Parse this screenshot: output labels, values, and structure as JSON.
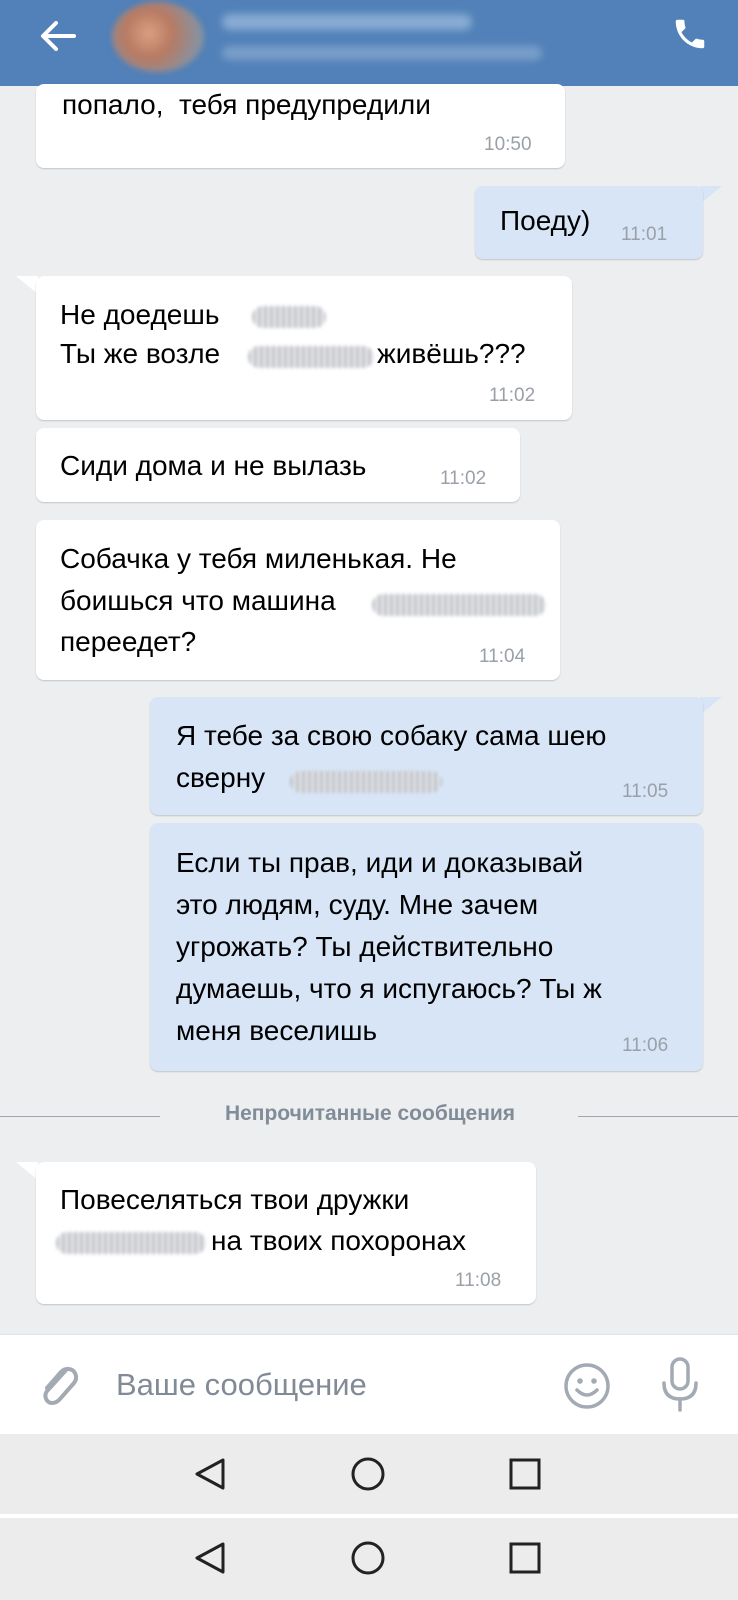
{
  "header": {
    "back_icon": "arrow-left-icon",
    "call_icon": "phone-icon",
    "accent_color": "#5181b8"
  },
  "messages": [
    {
      "direction": "in",
      "lines": [
        "попало,  тебя предупредили"
      ],
      "time": "10:50"
    },
    {
      "direction": "out",
      "lines": [
        "Поеду)"
      ],
      "time": "11:01"
    },
    {
      "direction": "in",
      "lines": [
        "Не доедешь",
        "Ты же возле",
        "живёшь???"
      ],
      "time": "11:02"
    },
    {
      "direction": "in",
      "lines": [
        "Сиди дома и не вылазь"
      ],
      "time": "11:02"
    },
    {
      "direction": "in",
      "lines": [
        "Собачка у тебя миленькая. Не",
        "боишься что машина",
        "переедет?"
      ],
      "time": "11:04"
    },
    {
      "direction": "out",
      "lines": [
        "Я тебе за свою собаку сама шею",
        "сверну"
      ],
      "time": "11:05"
    },
    {
      "direction": "out",
      "lines": [
        "Если ты прав, иди и доказывай",
        "это людям, суду. Мне зачем",
        "угрожать? Ты действительно",
        "думаешь, что я испугаюсь? Ты ж",
        "меня веселишь"
      ],
      "time": "11:06"
    },
    {
      "direction": "in",
      "lines": [
        "Повеселяться твои дружки",
        "на твоих похоронах"
      ],
      "time": "11:08"
    }
  ],
  "unread_divider": "Непрочитанные сообщения",
  "composer": {
    "placeholder": "Ваше сообщение",
    "attach_icon": "paperclip-icon",
    "emoji_icon": "smile-icon",
    "mic_icon": "microphone-icon"
  },
  "navigation": {
    "icons": [
      "triangle-back-icon",
      "circle-home-icon",
      "square-recent-icon"
    ]
  }
}
